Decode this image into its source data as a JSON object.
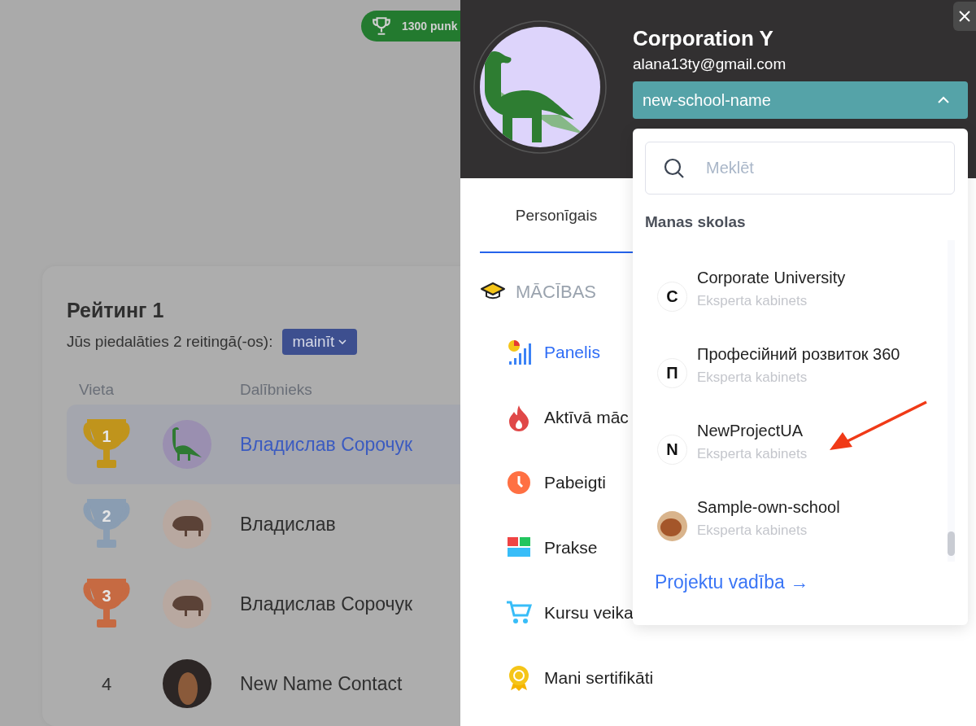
{
  "points_badge": {
    "text": "1300 punk"
  },
  "rating_card": {
    "title": "Рейтинг 1",
    "subtitle": "Jūs piedalāties 2 reitingā(-os):",
    "change_button": "mainīt",
    "columns": [
      "Vieta",
      "Dalībnieks"
    ],
    "rows": [
      {
        "place": {
          "kind": "trophy",
          "text": "1",
          "color": "#c0941c"
        },
        "avatar": {
          "kind": "dinosaur"
        },
        "name": "Владислав Сорочук",
        "selected": true
      },
      {
        "place": {
          "kind": "trophy",
          "text": "2",
          "color": "#8a9db2"
        },
        "avatar": {
          "kind": "bison"
        },
        "name": "Владислав",
        "selected": false
      },
      {
        "place": {
          "kind": "trophy",
          "text": "3",
          "color": "#c66a42"
        },
        "avatar": {
          "kind": "bison"
        },
        "name": "Владислав Сорочук",
        "selected": false
      },
      {
        "place": {
          "kind": "number",
          "text": "4"
        },
        "avatar": {
          "kind": "photo"
        },
        "name": "New Name Contact",
        "selected": false
      }
    ]
  },
  "drawer": {
    "profile": {
      "name": "Corporation Y",
      "email": "alana13ty@gmail.com"
    },
    "school_select": {
      "value": "new-school-name",
      "expanded": true
    },
    "tabs": [
      {
        "label": "Personīgais",
        "selected": true
      }
    ],
    "section": {
      "title": "MĀCĪBAS",
      "items": [
        {
          "label": "Panelis",
          "selected": true
        },
        {
          "label": "Aktīvā māc",
          "selected": false
        },
        {
          "label": "Pabeigti",
          "selected": false
        },
        {
          "label": "Prakse",
          "selected": false
        },
        {
          "label": "Kursu veika",
          "selected": false
        },
        {
          "label": "Mani sertifikāti",
          "selected": false
        }
      ]
    },
    "dropdown": {
      "search": {
        "placeholder": "Meklēt"
      },
      "heading": "Manas skolas",
      "schools": [
        {
          "kind": "letter",
          "letter": "C",
          "name": "Corporate University",
          "role": "Eksperta kabinets"
        },
        {
          "kind": "letter",
          "letter": "П",
          "name": "Професійний розвиток 360",
          "role": "Eksperta kabinets"
        },
        {
          "kind": "letter",
          "letter": "N",
          "name": "NewProjectUA",
          "role": "Eksperta kabinets"
        },
        {
          "kind": "photo",
          "name": "Sample-own-school",
          "role": "Eksperta kabinets"
        }
      ],
      "link": "Projektu vadība →"
    }
  }
}
